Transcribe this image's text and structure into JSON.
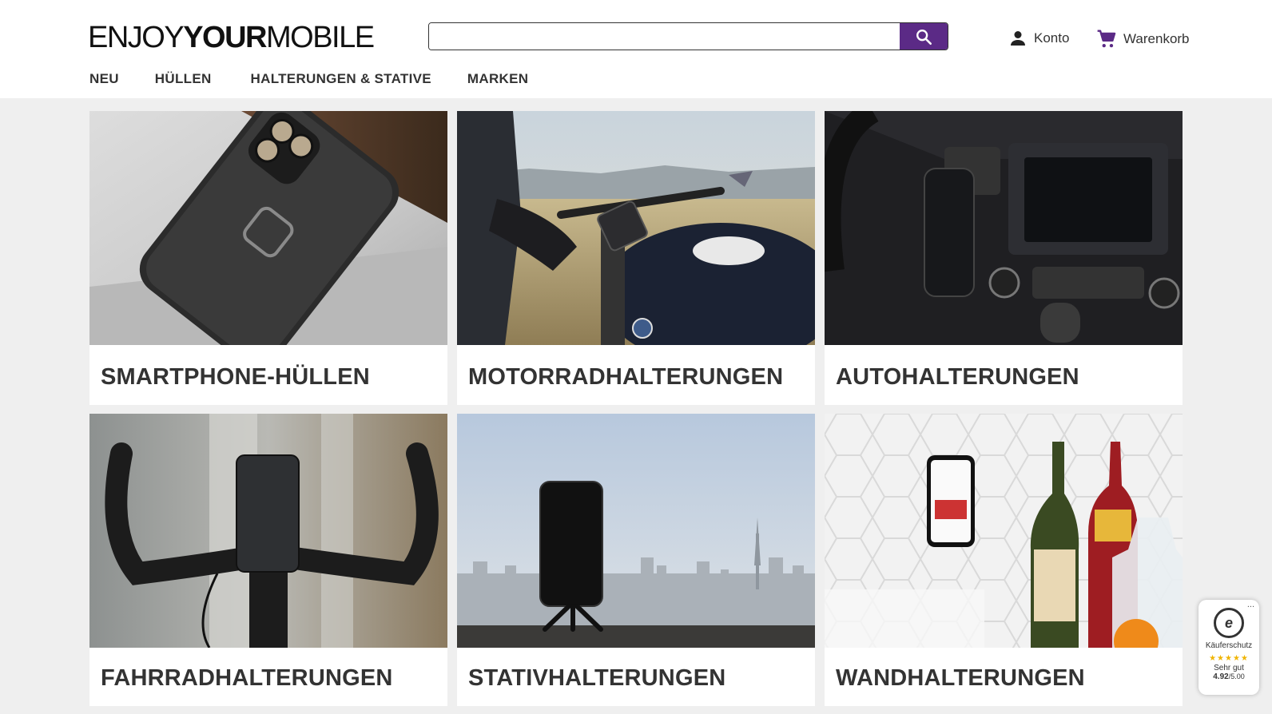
{
  "logo": {
    "part1": "ENJOY",
    "part2": "YOUR",
    "part3": "MOBILE"
  },
  "search": {
    "value": "",
    "placeholder": "",
    "icon": "search-icon"
  },
  "header_actions": {
    "account_label": "Konto",
    "cart_label": "Warenkorb"
  },
  "nav": {
    "items": [
      "NEU",
      "HÜLLEN",
      "HALTERUNGEN & STATIVE",
      "MARKEN"
    ]
  },
  "categories": [
    {
      "label": "SMARTPHONE-HÜLLEN"
    },
    {
      "label": "MOTORRADHALTERUNGEN"
    },
    {
      "label": "AUTOHALTERUNGEN"
    },
    {
      "label": "FAHRRADHALTERUNGEN"
    },
    {
      "label": "STATIVHALTERUNGEN"
    },
    {
      "label": "WANDHALTERUNGEN"
    }
  ],
  "trust_badge": {
    "seal_letter": "e",
    "title": "Käuferschutz",
    "stars": "★★★★★",
    "rating_text": "Sehr gut",
    "score": "4.92",
    "score_max": "/5.00",
    "menu": "..."
  },
  "colors": {
    "brand_purple": "#5b2a86",
    "background": "#efefef"
  }
}
